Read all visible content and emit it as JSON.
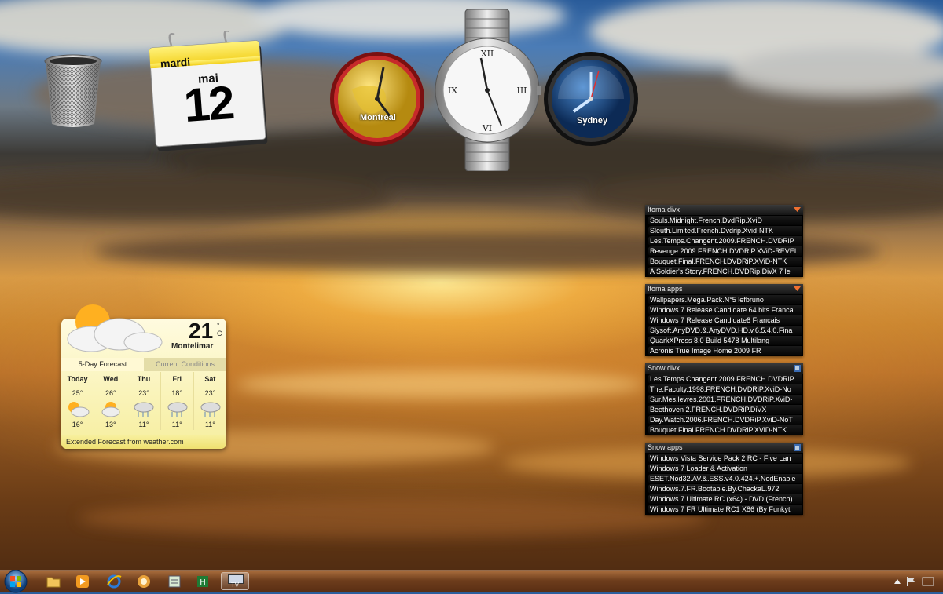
{
  "desktop": {
    "calendar": {
      "weekday": "mardi",
      "month": "mai",
      "day": "12"
    },
    "clocks": [
      {
        "city": "Montreal"
      },
      {
        "city": ""
      },
      {
        "city": "Sydney"
      }
    ],
    "weather": {
      "temperature": "21",
      "unit": "°",
      "unit_letter": "C",
      "city": "Montelimar",
      "tab_forecast": "5-Day Forecast",
      "tab_current": "Current Conditions",
      "days": [
        {
          "name": "Today",
          "hi": "25°",
          "lo": "16°",
          "icon": "partly-sunny-icon"
        },
        {
          "name": "Wed",
          "hi": "26°",
          "lo": "13°",
          "icon": "partly-sunny-icon"
        },
        {
          "name": "Thu",
          "hi": "23°",
          "lo": "11°",
          "icon": "snow-icon"
        },
        {
          "name": "Fri",
          "hi": "18°",
          "lo": "11°",
          "icon": "snow-icon"
        },
        {
          "name": "Sat",
          "hi": "23°",
          "lo": "11°",
          "icon": "snow-icon"
        }
      ],
      "footer": "Extended Forecast from weather.com"
    },
    "feeds": [
      {
        "title": "Itoma divx",
        "items": [
          "Souls.Midnight.French.DvdRip.XviD",
          "Sleuth.Limited.French.Dvdrip.Xvid-NTK",
          "Les.Temps.Changent.2009.FRENCH.DVDRiP",
          "Revenge.2009.FRENCH.DVDRiP.XViD-REVEI",
          "Bouquet.Final.FRENCH.DVDRiP.XViD-NTK",
          "A Soldier's Story.FRENCH.DVDRip.DivX 7 le"
        ]
      },
      {
        "title": "Itoma apps",
        "items": [
          "Wallpapers.Mega.Pack.N°5 lefbruno",
          "Windows 7 Release Candidate 64 bits Franca",
          "Windows 7 Release Candidate8 Francais",
          "Slysoft.AnyDVD.&.AnyDVD.HD.v.6.5.4.0.Fina",
          "QuarkXPress 8.0 Build 5478 Multilang",
          "Acronis True Image Home 2009  FR"
        ]
      },
      {
        "title": "Snow divx",
        "items": [
          "Les.Temps.Changent.2009.FRENCH.DVDRiP",
          "The.Faculty.1998.FRENCH.DVDRiP.XviD-No",
          "Sur.Mes.levres.2001.FRENCH.DVDRiP.XviD-",
          "Beethoven 2.FRENCH.DVDRiP.DiVX",
          "Day.Watch.2006.FRENCH.DVDRiP.XviD-NoT",
          "Bouquet.Final.FRENCH.DVDRiP.XViD-NTK"
        ]
      },
      {
        "title": "Snow apps",
        "items": [
          "Windows Vista Service Pack 2 RC - Five Lan",
          "Windows 7  Loader & Activation",
          "ESET.Nod32.AV.&.ESS.v4.0.424.+.NodEnable",
          "Windows.7.FR.Bootable.By.ChackaL.972",
          "Windows 7 Ultimate RC (x64) - DVD (French)",
          "Windows 7 FR Ultimate RC1 X86 (By Funkyt"
        ]
      }
    ]
  },
  "taskbar": {
    "active_label": "TV",
    "icons": [
      "folder-icon",
      "media-player-icon",
      "internet-explorer-icon",
      "messenger-icon",
      "notepad-icon",
      "spreadsheet-icon",
      "tv-icon"
    ]
  },
  "colors": {
    "feed_bg": "#000000",
    "weather_bg": "#fff9d4",
    "taskbar": "#6e3d1c"
  }
}
